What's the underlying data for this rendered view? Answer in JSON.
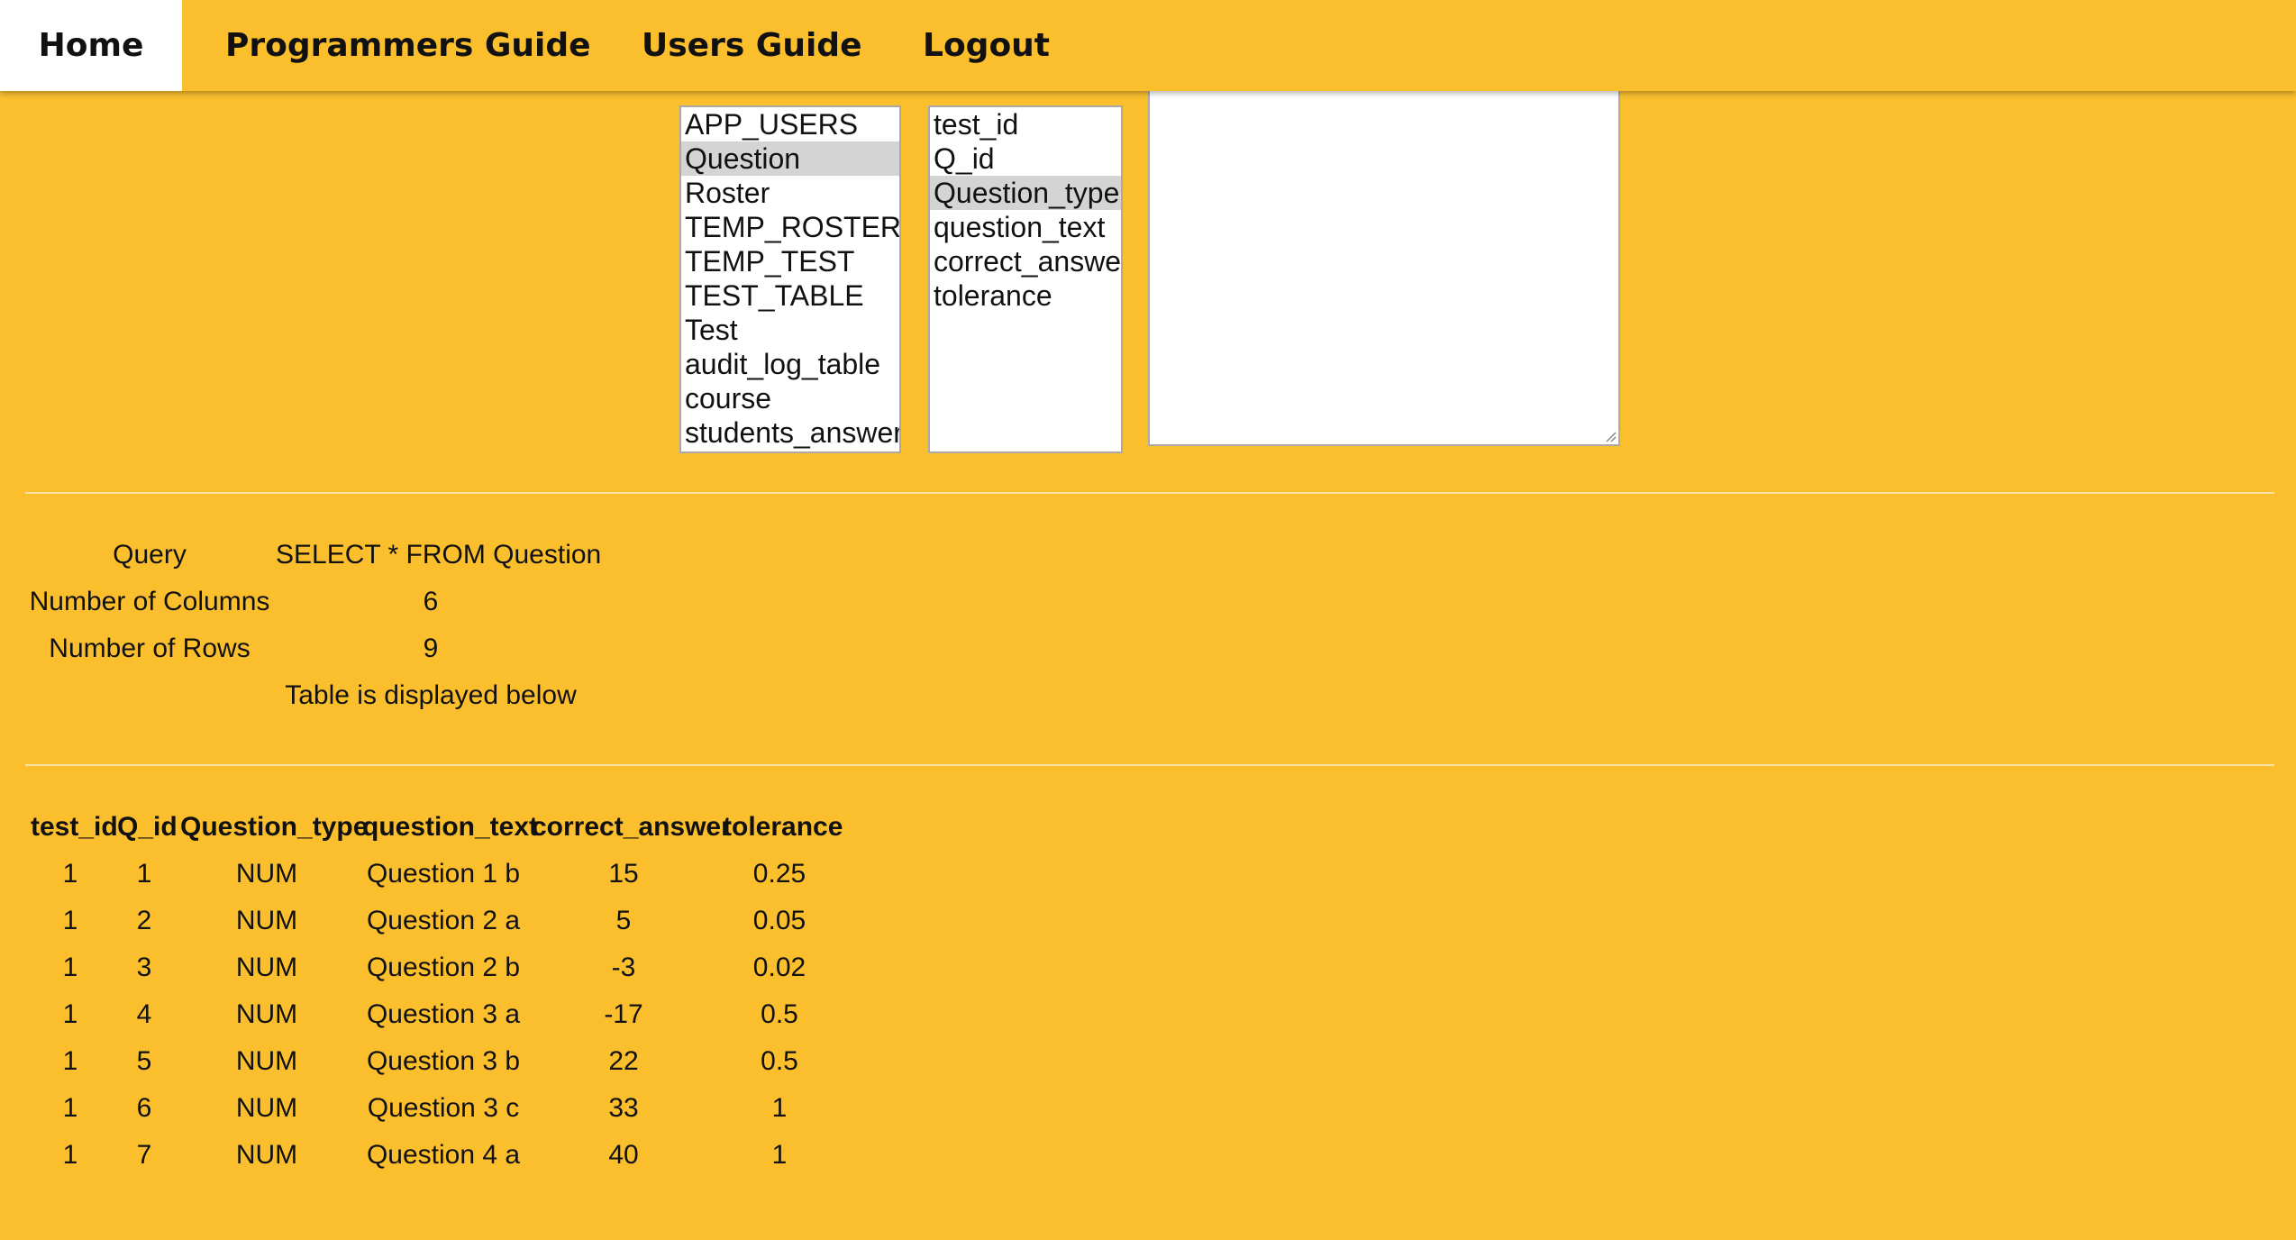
{
  "nav": {
    "items": [
      "Home",
      "Programmers Guide",
      "Users Guide",
      "Logout"
    ],
    "active": "Home"
  },
  "tables_list": {
    "options": [
      "APP_USERS",
      "Question",
      "Roster",
      "TEMP_ROSTER",
      "TEMP_TEST",
      "TEST_TABLE",
      "Test",
      "audit_log_table",
      "course",
      "students_answers"
    ],
    "selected": "Question"
  },
  "columns_list": {
    "options": [
      "test_id",
      "Q_id",
      "Question_type",
      "question_text",
      "correct_answer",
      "tolerance"
    ],
    "selected": "Question_type"
  },
  "query_textarea": {
    "value": ""
  },
  "info": {
    "query_label": "Query",
    "query_value": "SELECT * FROM Question",
    "columns_label": "Number of Columns",
    "columns_value": "6",
    "rows_label": "Number of Rows",
    "rows_value": "9",
    "note": "Table is displayed below"
  },
  "result_table": {
    "headers": [
      "test_id",
      "Q_id",
      "Question_type",
      "question_text",
      "correct_answer",
      "tolerance"
    ],
    "rows": [
      [
        "1",
        "1",
        "NUM",
        "Question 1 b",
        "15",
        "0.25"
      ],
      [
        "1",
        "2",
        "NUM",
        "Question 2 a",
        "5",
        "0.05"
      ],
      [
        "1",
        "3",
        "NUM",
        "Question 2 b",
        "-3",
        "0.02"
      ],
      [
        "1",
        "4",
        "NUM",
        "Question 3 a",
        "-17",
        "0.5"
      ],
      [
        "1",
        "5",
        "NUM",
        "Question 3 b",
        "22",
        "0.5"
      ],
      [
        "1",
        "6",
        "NUM",
        "Question 3 c",
        "33",
        "1"
      ],
      [
        "1",
        "7",
        "NUM",
        "Question 4 a",
        "40",
        "1"
      ]
    ]
  },
  "colors": {
    "background": "#fbbf2e",
    "selected_option": "#d4d4d4"
  }
}
